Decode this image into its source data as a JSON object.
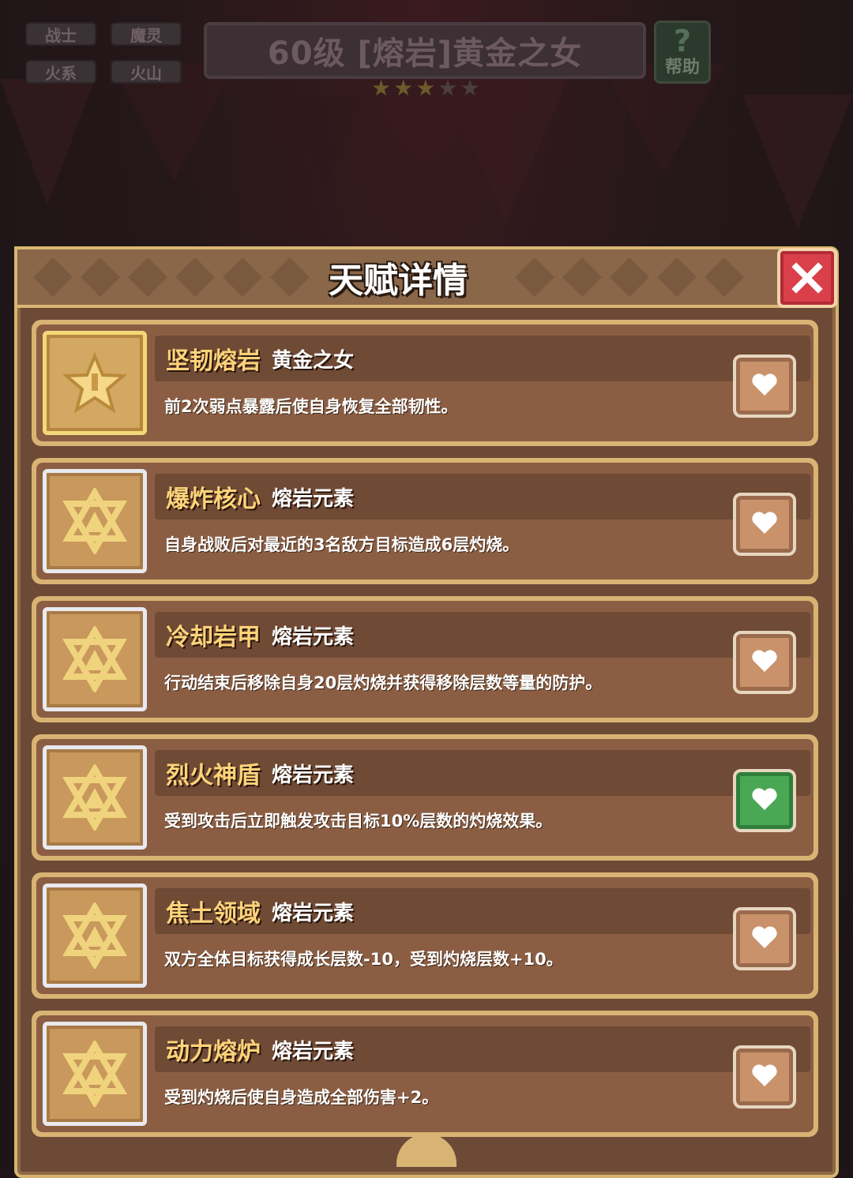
{
  "tags": [
    "战士",
    "魔灵",
    "火系",
    "火山"
  ],
  "hero": {
    "title": "60级 [熔岩]黄金之女",
    "stars_filled": 3,
    "stars_total": 5
  },
  "help": {
    "label": "帮助"
  },
  "panel": {
    "title": "天赋详情"
  },
  "talents": [
    {
      "name": "坚韧熔岩",
      "tag": "黄金之女",
      "desc": "前2次弱点暴露后使自身恢复全部韧性。",
      "icon": "star-icon",
      "favorited": false
    },
    {
      "name": "爆炸核心",
      "tag": "熔岩元素",
      "desc": "自身战败后对最近的3名敌方目标造成6层灼烧。",
      "icon": "hexagram-icon",
      "favorited": false
    },
    {
      "name": "冷却岩甲",
      "tag": "熔岩元素",
      "desc": "行动结束后移除自身20层灼烧并获得移除层数等量的防护。",
      "icon": "hexagram-icon",
      "favorited": false
    },
    {
      "name": "烈火神盾",
      "tag": "熔岩元素",
      "desc": "受到攻击后立即触发攻击目标10%层数的灼烧效果。",
      "icon": "hexagram-icon",
      "favorited": true
    },
    {
      "name": "焦土领域",
      "tag": "熔岩元素",
      "desc": "双方全体目标获得成长层数-10，受到灼烧层数+10。",
      "icon": "hexagram-icon",
      "favorited": false
    },
    {
      "name": "动力熔炉",
      "tag": "熔岩元素",
      "desc": "受到灼烧后使自身造成全部伤害+2。",
      "icon": "hexagram-icon",
      "favorited": false
    }
  ],
  "colors": {
    "panel_border": "#d9b674",
    "talent_name": "#ffd37a",
    "favorite_on": "#4aa854",
    "close_button": "#d9404a"
  }
}
